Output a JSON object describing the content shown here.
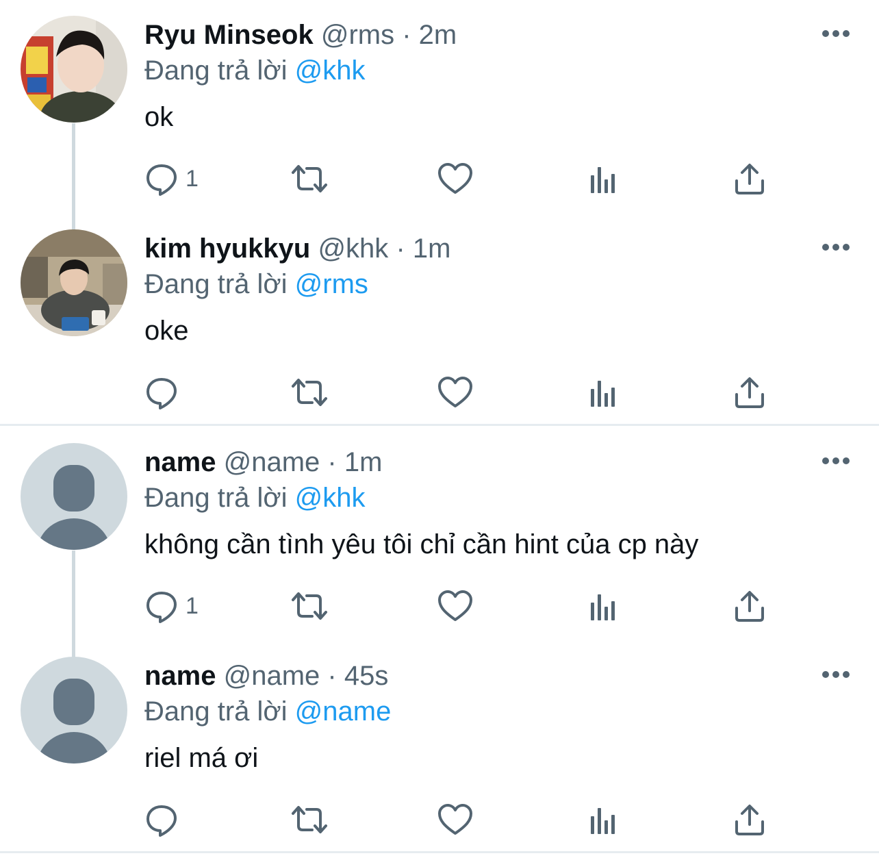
{
  "colors": {
    "text": "#0f1419",
    "muted": "#536471",
    "mention": "#1d9bf0",
    "thread_line": "#cfd9de",
    "divider": "#e6ecf0",
    "default_avatar_bg": "#cfd9de",
    "default_avatar_fg": "#657786"
  },
  "icons": {
    "more": "more-icon",
    "reply": "reply-icon",
    "retweet": "retweet-icon",
    "like": "like-icon",
    "views": "views-icon",
    "share": "share-icon"
  },
  "tweets": [
    {
      "display_name": "Ryu Minseok",
      "handle": "@rms",
      "separator": "·",
      "time": "2m",
      "replying_label": "Đang trả lời",
      "replying_to": "@khk",
      "text": "ok",
      "reply_count": "1",
      "avatar": "photo"
    },
    {
      "display_name": "kim hyukkyu",
      "handle": "@khk",
      "separator": "·",
      "time": "1m",
      "replying_label": "Đang trả lời",
      "replying_to": "@rms",
      "text": "oke",
      "reply_count": "",
      "avatar": "photo"
    },
    {
      "display_name": "name",
      "handle": "@name",
      "separator": "·",
      "time": "1m",
      "replying_label": "Đang trả lời",
      "replying_to": "@khk",
      "text": "không cần tình yêu tôi chỉ cần hint của cp này",
      "reply_count": "1",
      "avatar": "default"
    },
    {
      "display_name": "name",
      "handle": "@name",
      "separator": "·",
      "time": "45s",
      "replying_label": "Đang trả lời",
      "replying_to": "@name",
      "text": "riel má ơi",
      "reply_count": "",
      "avatar": "default"
    }
  ]
}
